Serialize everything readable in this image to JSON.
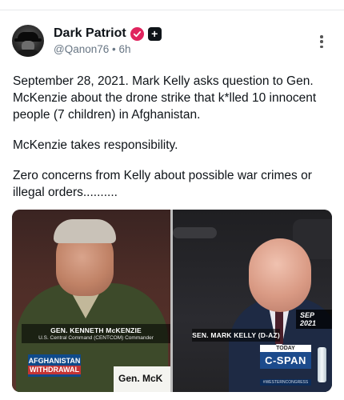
{
  "post": {
    "author": {
      "display_name": "Dark Patriot",
      "handle": "@Qanon76",
      "separator": "•",
      "time_ago": "6h",
      "badges": [
        "verified-badge",
        "plus-badge"
      ]
    },
    "more_icon": "more-vertical-icon",
    "paragraphs": [
      "September 28, 2021. Mark Kelly asks question to Gen. McKenzie about the drone strike that k*lled 10 innocent people (7 children) in Afghanistan.",
      "McKenzie takes responsibility.",
      "Zero concerns from Kelly about possible war crimes or illegal orders.........."
    ],
    "media": {
      "left": {
        "caption_name": "GEN. KENNETH McKENZIE",
        "caption_title": "U.S. Central Command (CENTCOM) Commander",
        "badge_line1": "AFGHANISTAN",
        "badge_line2": "WITHDRAWAL",
        "nameplate": "Gen. McK"
      },
      "right": {
        "caption_name": "SEN. MARK KELLY (D-AZ)",
        "date_tag": "SEP 2021",
        "network_today": "TODAY",
        "network_logo": "C-SPAN",
        "ticker": "#WESTERNCONGRESS"
      }
    }
  },
  "colors": {
    "verified": "#e0245e",
    "text": "#0f1419",
    "muted": "#687684"
  }
}
